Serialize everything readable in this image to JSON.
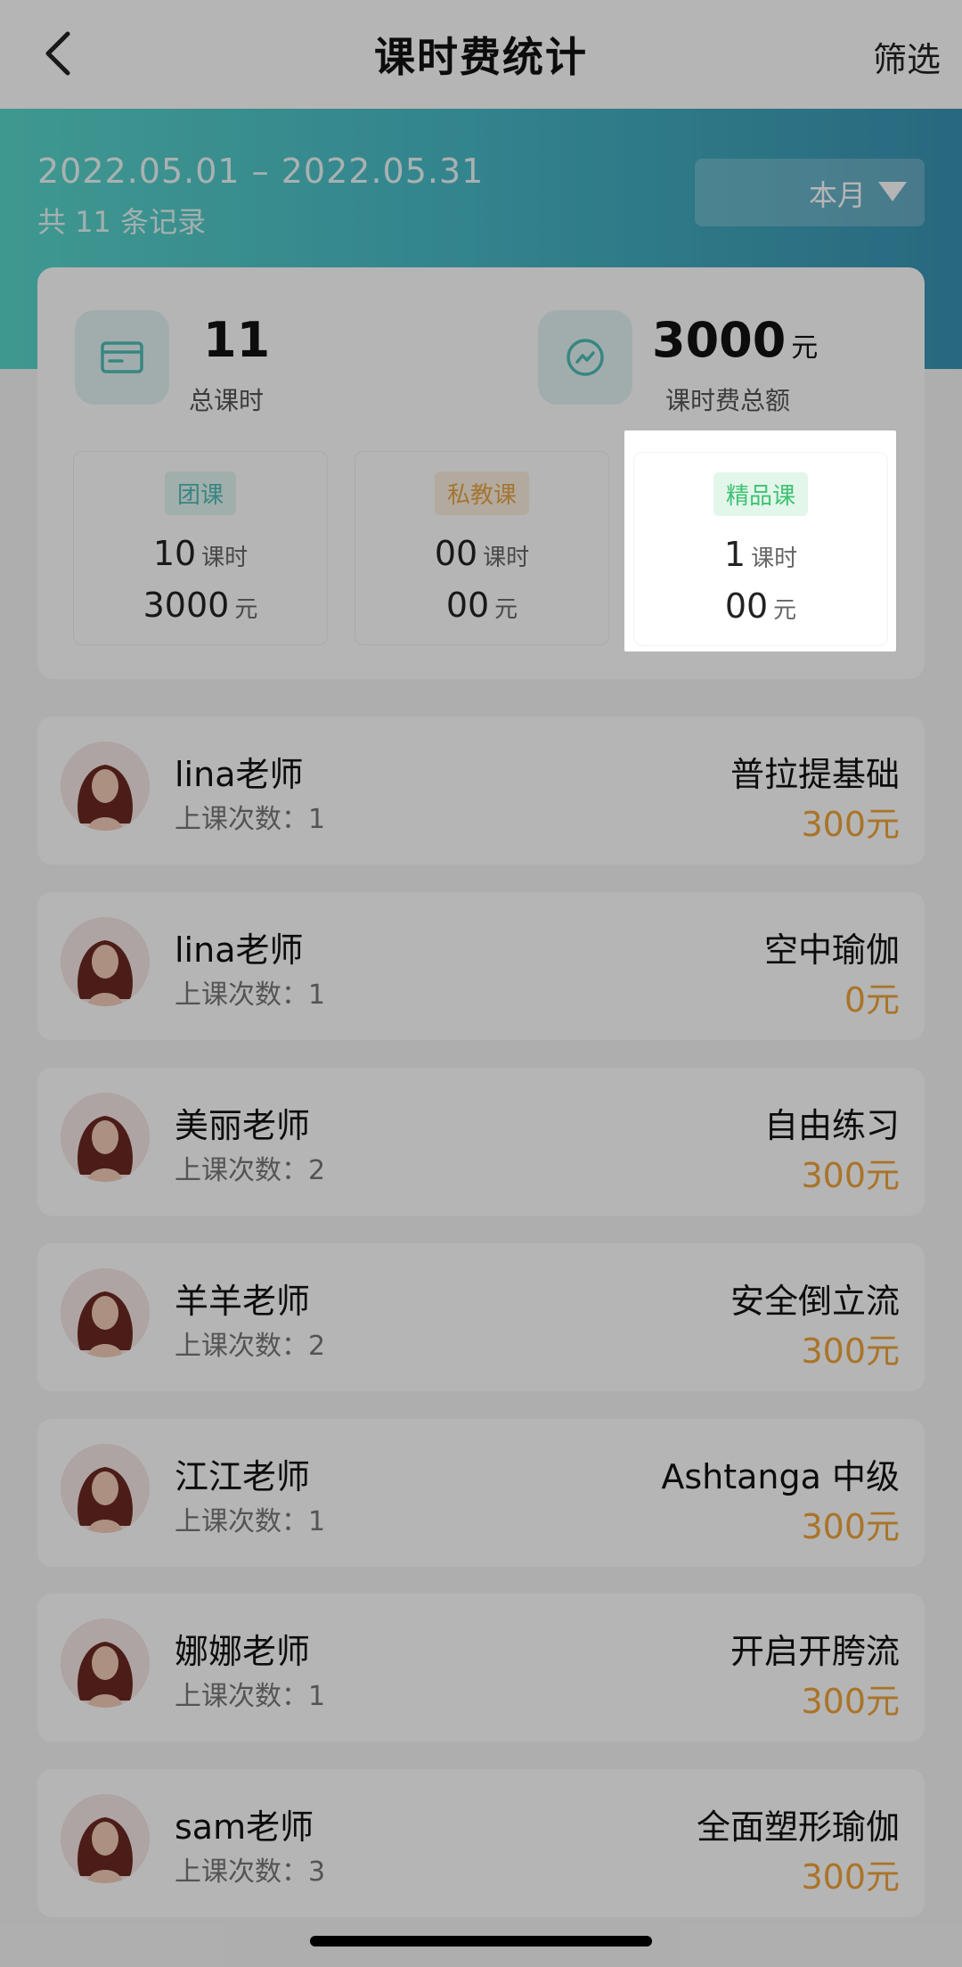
{
  "header": {
    "title": "课时费统计",
    "filter_label": "筛选"
  },
  "banner": {
    "date_range": "2022.05.01 – 2022.05.31",
    "record_count": "共 11 条记录",
    "period_selected": "本月"
  },
  "summary": {
    "total_hours_value": "11",
    "total_hours_label": "总课时",
    "total_fee_value": "3000",
    "total_fee_unit": "元",
    "total_fee_label": "课时费总额"
  },
  "course_types": [
    {
      "tag": "团课",
      "hours": "10",
      "hours_unit": "课时",
      "fee": "3000",
      "fee_unit": "元",
      "tag_color": "#4fbdb6",
      "tag_bg": "#e2f5f3"
    },
    {
      "tag": "私教课",
      "hours": "00",
      "hours_unit": "课时",
      "fee": "00",
      "fee_unit": "元",
      "tag_color": "#e8a547",
      "tag_bg": "#fcf0e0"
    },
    {
      "tag": "精品课",
      "hours": "1",
      "hours_unit": "课时",
      "fee": "00",
      "fee_unit": "元",
      "tag_color": "#3ec273",
      "tag_bg": "#e2f6ea"
    }
  ],
  "records": [
    {
      "teacher": "lina老师",
      "count": "上课次数：1",
      "course": "普拉提基础",
      "fee": "300元"
    },
    {
      "teacher": "lina老师",
      "count": "上课次数：1",
      "course": "空中瑜伽",
      "fee": "0元"
    },
    {
      "teacher": "美丽老师",
      "count": "上课次数：2",
      "course": "自由练习",
      "fee": "300元"
    },
    {
      "teacher": "羊羊老师",
      "count": "上课次数：2",
      "course": "安全倒立流",
      "fee": "300元"
    },
    {
      "teacher": "江江老师",
      "count": "上课次数：1",
      "course": "Ashtanga 中级",
      "fee": "300元"
    },
    {
      "teacher": "娜娜老师",
      "count": "上课次数：1",
      "course": "开启开胯流",
      "fee": "300元"
    },
    {
      "teacher": "sam老师",
      "count": "上课次数：3",
      "course": "全面塑形瑜伽",
      "fee": "300元"
    }
  ],
  "colors": {
    "accent": "#4fbdb6",
    "fee": "#f0a43a",
    "gradient_start": "#5ad6cb",
    "gradient_end": "#3a93b3"
  },
  "icons": {
    "back": "chevron-left-icon",
    "hours": "card-icon",
    "fee": "trend-icon",
    "dropdown": "caret-down-icon"
  }
}
